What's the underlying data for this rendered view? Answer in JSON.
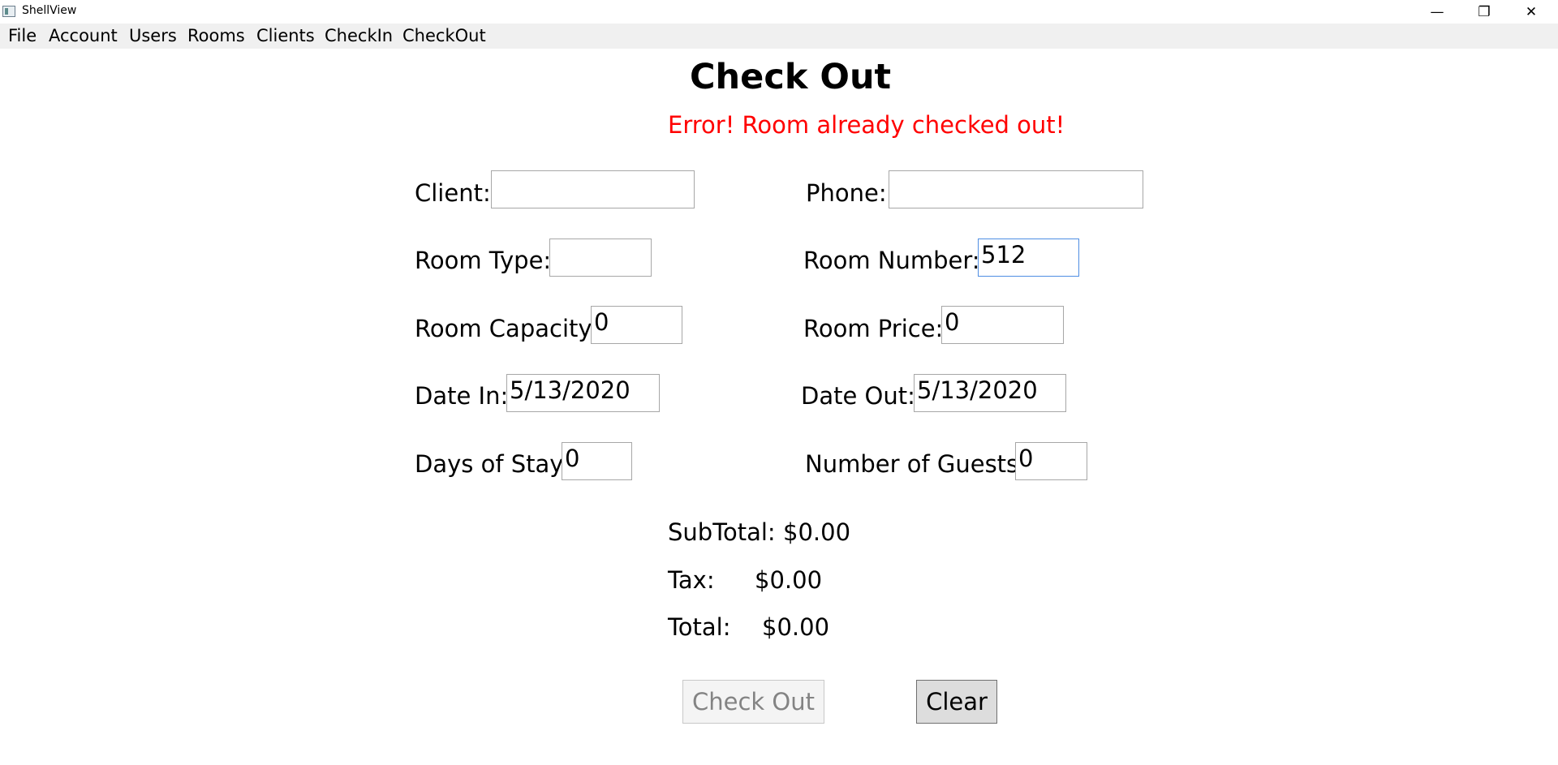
{
  "window": {
    "title": "ShellView",
    "controls": {
      "minimize": "—",
      "restore": "❐",
      "close": "✕"
    }
  },
  "menu": [
    "File",
    "Account",
    "Users",
    "Rooms",
    "Clients",
    "CheckIn",
    "CheckOut"
  ],
  "page": {
    "title": "Check Out",
    "error": "Error! Room already checked out!"
  },
  "form": {
    "client": {
      "label": "Client:",
      "value": ""
    },
    "phone": {
      "label": "Phone:",
      "value": ""
    },
    "room_type": {
      "label": "Room Type:",
      "value": ""
    },
    "room_number": {
      "label": "Room Number:",
      "value": "512"
    },
    "room_capacity": {
      "label": "Room Capacity:",
      "value": "0"
    },
    "room_price": {
      "label": "Room Price:",
      "value": "0"
    },
    "date_in": {
      "label": "Date In:",
      "value": "5/13/2020"
    },
    "date_out": {
      "label": "Date Out:",
      "value": "5/13/2020"
    },
    "days_of_stay": {
      "label": "Days of Stay:",
      "value": "0"
    },
    "number_of_guests": {
      "label": "Number of Guests:",
      "value": "0"
    }
  },
  "summary": {
    "subtotal": {
      "label": "SubTotal:",
      "value": "$0.00"
    },
    "tax": {
      "label": "Tax:",
      "value": "$0.00"
    },
    "total": {
      "label": "Total:",
      "value": "$0.00"
    }
  },
  "buttons": {
    "check_out": "Check Out",
    "clear": "Clear"
  }
}
